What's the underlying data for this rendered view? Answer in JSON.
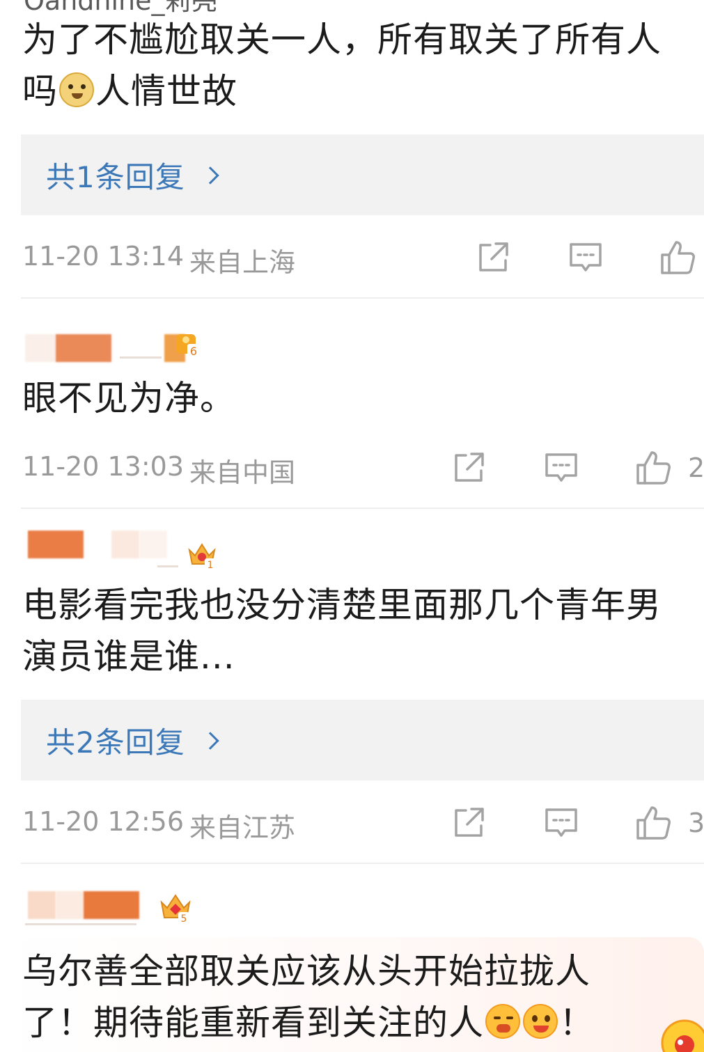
{
  "comments": [
    {
      "user_fragment": "Oandhine_莉亮",
      "text_line1": "为了不尴尬取关一人，所有取关了所有人",
      "text_line2_pre": "吗",
      "text_line2_post": "人情世故",
      "reply_label": "共1条回复",
      "time": "11-20 13:14",
      "location": "来自上海",
      "likes": ""
    },
    {
      "level": "6",
      "text_line1": "眼不见为净。",
      "time": "11-20 13:03",
      "location": "来自中国",
      "likes": "2"
    },
    {
      "level": "1",
      "text_line1": "电影看完我也没分清楚里面那几个青年男",
      "text_line2": "演员谁是谁...",
      "reply_label": "共2条回复",
      "time": "11-20 12:56",
      "location": "来自江苏",
      "likes": "3"
    },
    {
      "level": "5",
      "text_line1": "乌尔善全部取关应该从头开始拉拢人",
      "text_line2_pre": "了！期待能重新看到关注的人",
      "text_line2_post": "！"
    }
  ],
  "icons": {
    "share": "share-icon",
    "comment": "comment-icon",
    "like": "thumbs-up-icon",
    "badge": "vip-crown-badge-icon",
    "emoji_doge": "doge-emoji-icon",
    "emoji_cry": "crying-emoji-icon",
    "emoji_happy": "happy-emoji-icon"
  },
  "colors": {
    "reply_link": "#3c78b7",
    "meta_text": "#999999",
    "reply_bg": "#f2f2f2"
  }
}
